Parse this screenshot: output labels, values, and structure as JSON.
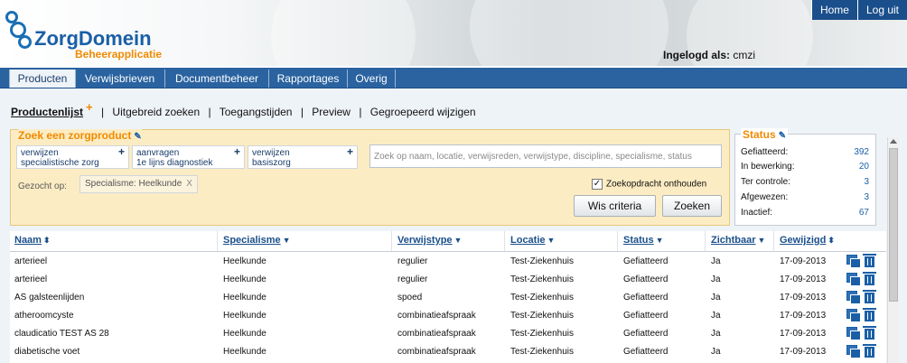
{
  "header": {
    "logo_title": "ZorgDomein",
    "logo_subtitle": "Beheerapplicatie",
    "links": [
      "Home",
      "Log uit"
    ],
    "login_label": "Ingelogd als:",
    "login_user": "cmzi"
  },
  "nav": {
    "tabs": [
      {
        "label": "Producten",
        "active": true
      },
      {
        "label": "Verwijsbrieven"
      },
      {
        "label": "Documentbeheer"
      },
      {
        "label": "Rapportages"
      },
      {
        "label": "Overig"
      }
    ]
  },
  "subnav": {
    "items": [
      "Productenlijst",
      "Uitgebreid zoeken",
      "Toegangstijden",
      "Preview",
      "Gegroepeerd wijzigen"
    ],
    "add_glyph": "+",
    "separator": "|"
  },
  "search": {
    "title": "Zoek een zorgproduct",
    "chips": [
      {
        "line1": "verwijzen",
        "line2": "specialistische zorg"
      },
      {
        "line1": "aanvragen",
        "line2": "1e lijns diagnostiek"
      },
      {
        "line1": "verwijzen",
        "line2": "basiszorg"
      }
    ],
    "placeholder": "Zoek op naam, locatie, verwijsreden, verwijstype, discipline, specialisme, status",
    "searched_label": "Gezocht op:",
    "filter_chip": "Specialisme: Heelkunde",
    "filter_close": "X",
    "remember_label": "Zoekopdracht onthouden",
    "remember_checked": true,
    "clear_button": "Wis criteria",
    "search_button": "Zoeken"
  },
  "status": {
    "title": "Status",
    "rows": [
      {
        "label": "Gefiatteerd:",
        "value": "392"
      },
      {
        "label": "In bewerking:",
        "value": "20"
      },
      {
        "label": "Ter controle:",
        "value": "3"
      },
      {
        "label": "Afgewezen:",
        "value": "3"
      },
      {
        "label": "Inactief:",
        "value": "67"
      }
    ]
  },
  "table": {
    "columns": [
      "Naam",
      "Specialisme",
      "Verwijstype",
      "Locatie",
      "Status",
      "Zichtbaar",
      "Gewijzigd"
    ],
    "rows": [
      [
        "arterieel",
        "Heelkunde",
        "regulier",
        "Test-Ziekenhuis",
        "Gefiatteerd",
        "Ja",
        "17-09-2013"
      ],
      [
        "arterieel",
        "Heelkunde",
        "regulier",
        "Test-Ziekenhuis",
        "Gefiatteerd",
        "Ja",
        "17-09-2013"
      ],
      [
        "AS galsteenlijden",
        "Heelkunde",
        "spoed",
        "Test-Ziekenhuis",
        "Gefiatteerd",
        "Ja",
        "17-09-2013"
      ],
      [
        "atheroomcyste",
        "Heelkunde",
        "combinatieafspraak",
        "Test-Ziekenhuis",
        "Gefiatteerd",
        "Ja",
        "17-09-2013"
      ],
      [
        "claudicatio TEST AS 28",
        "Heelkunde",
        "combinatieafspraak",
        "Test-Ziekenhuis",
        "Gefiatteerd",
        "Ja",
        "17-09-2013"
      ],
      [
        "diabetische voet",
        "Heelkunde",
        "combinatieafspraak",
        "Test-Ziekenhuis",
        "Gefiatteerd",
        "Ja",
        "17-09-2013"
      ]
    ]
  },
  "colors": {
    "brand_blue": "#1a5fa6",
    "nav_blue": "#2a63a0",
    "orange": "#f08a00",
    "search_bg": "#fcecc3"
  }
}
